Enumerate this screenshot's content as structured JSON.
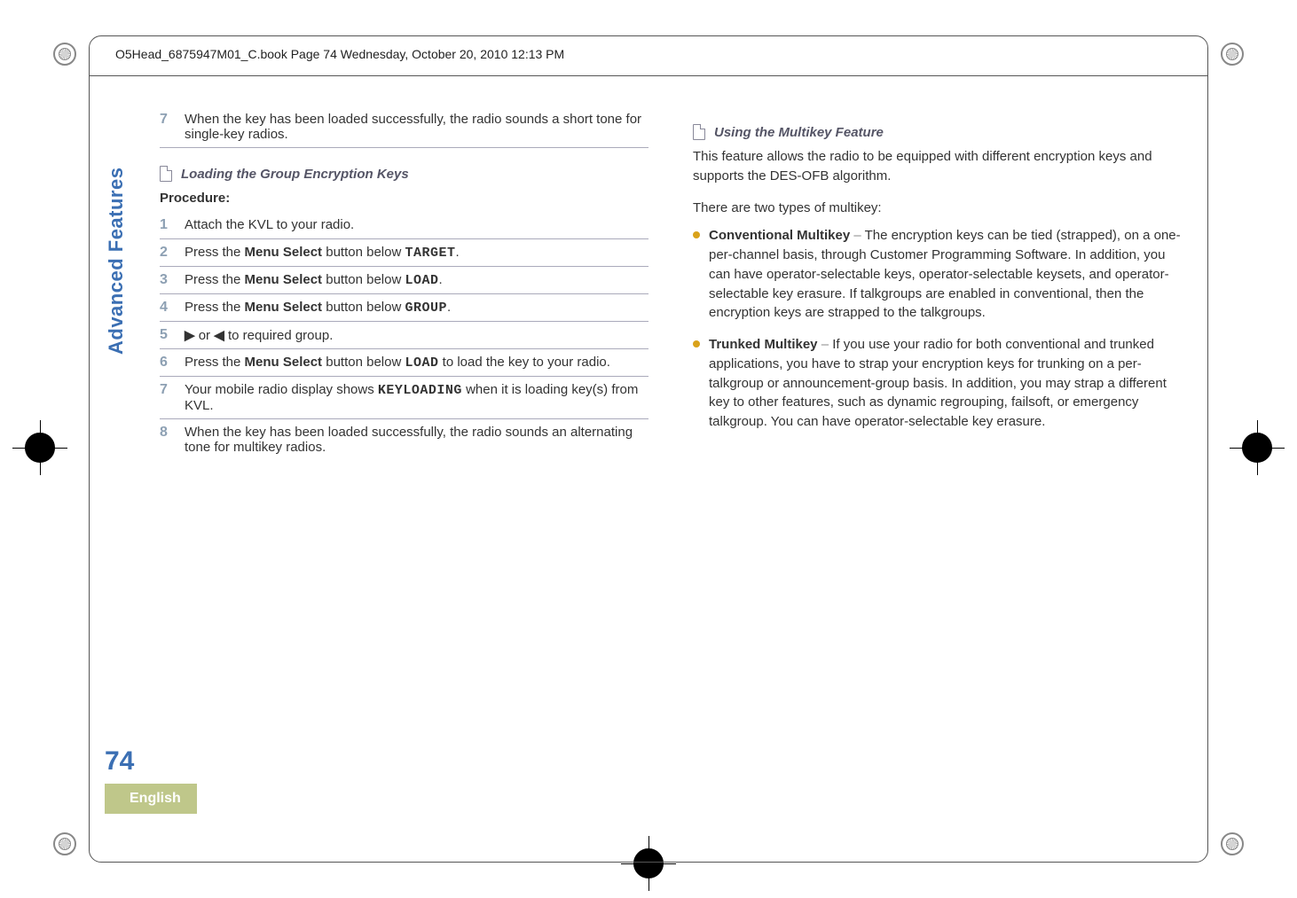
{
  "header": {
    "running": "O5Head_6875947M01_C.book  Page 74  Wednesday, October 20, 2010  12:13 PM"
  },
  "side": {
    "section": "Advanced Features",
    "page_number": "74",
    "language": "English"
  },
  "left_col": {
    "pre_step7_num": "7",
    "pre_step7_text": "When the key has been loaded successfully, the radio sounds a short tone for single-key radios.",
    "section1_title": "Loading the Group Encryption Keys",
    "procedure_label": "Procedure:",
    "steps": [
      {
        "num": "1",
        "text": "Attach the KVL to your radio."
      },
      {
        "num": "2",
        "pre": "Press the ",
        "bold": "Menu Select",
        "mid": " button below ",
        "lcd": "TARGET",
        "post": "."
      },
      {
        "num": "3",
        "pre": "Press the ",
        "bold": "Menu Select",
        "mid": " button below ",
        "lcd": "LOAD",
        "post": "."
      },
      {
        "num": "4",
        "pre": "Press the ",
        "bold": "Menu Select",
        "mid": " button below ",
        "lcd": "GROUP",
        "post": "."
      },
      {
        "num": "5",
        "arrows": true,
        "tail": " to required group."
      },
      {
        "num": "6",
        "pre": "Press the ",
        "bold": "Menu Select",
        "mid": " button below ",
        "lcd": "LOAD",
        "post": " to load the key to your radio."
      },
      {
        "num": "7",
        "pre": "Your mobile radio display shows ",
        "lcd": "KEYLOADING",
        "post": " when it is loading key(s) from KVL."
      },
      {
        "num": "8",
        "text": "When the key has been loaded successfully, the radio sounds an alternating tone for multikey radios."
      }
    ]
  },
  "right_col": {
    "section_title": "Using the Multikey Feature",
    "para1": "This feature allows the radio to be equipped with different encryption keys and supports the DES-OFB algorithm.",
    "para2": "There are two types of multikey:",
    "bullets": [
      {
        "title": "Conventional Multikey",
        "dash": " – ",
        "body": "The encryption keys can be tied (strapped), on a one-per-channel basis, through Customer Programming Software. In addition, you can have operator-selectable keys, operator-selectable keysets, and operator-selectable key erasure. If talkgroups are enabled in conventional, then the encryption keys are strapped to the talkgroups."
      },
      {
        "title": "Trunked Multikey",
        "dash": " – ",
        "body": "If you use your radio for both conventional and trunked applications, you have to strap your encryption keys for trunking on a per-talkgroup or announcement-group basis. In addition, you may strap a different key to other features, such as dynamic regrouping, failsoft, or emergency talkgroup. You can have operator-selectable key erasure."
      }
    ]
  }
}
